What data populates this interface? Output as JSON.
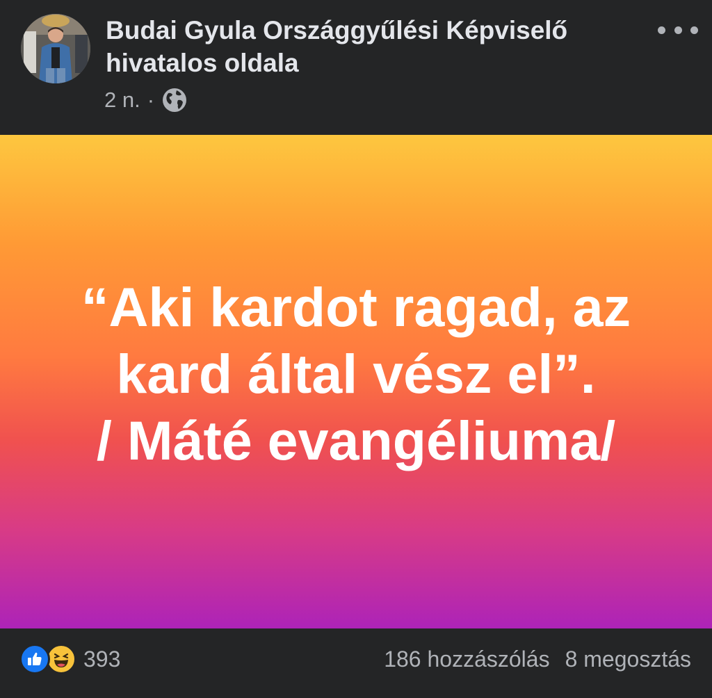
{
  "post": {
    "page_name": "Budai Gyula Országgyűlési Képviselő hivatalos oldala",
    "timestamp": "2 n.",
    "separator": "·",
    "privacy_icon": "globe-icon",
    "more_icon": "more-dots-icon",
    "background_gradient": [
      "#fdc73f",
      "#ff7a40",
      "#d83b86",
      "#ad23b8"
    ],
    "quote_lines": [
      "“Aki kardot ragad, az",
      "kard által vész el”.",
      "/ Máté evangéliuma/"
    ]
  },
  "footer": {
    "reaction_icons": [
      "like-icon",
      "haha-icon"
    ],
    "reaction_count": "393",
    "comments": "186 hozzászólás",
    "shares": "8 megosztás"
  },
  "colors": {
    "background": "#242526",
    "primary_text": "#e4e6eb",
    "secondary_text": "#b0b3b8",
    "like_blue": "#1877f2",
    "haha_yellow": "#f7c23b"
  }
}
